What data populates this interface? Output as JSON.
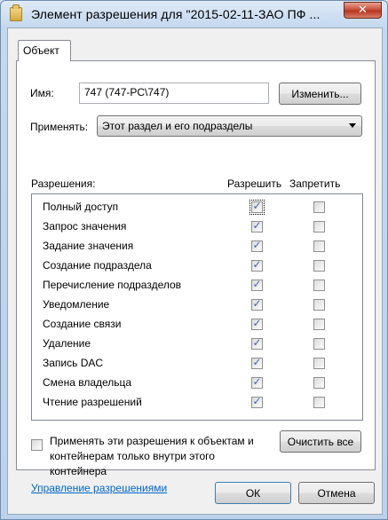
{
  "window": {
    "title": "Элемент разрешения для \"2015-02-11-ЗАО ПФ ...",
    "close_glyph": "✕"
  },
  "tabs": [
    {
      "label": "Объект"
    }
  ],
  "name_field": {
    "label": "Имя:",
    "value": "747 (747-PC\\747)"
  },
  "change_button": {
    "label": "Изменить..."
  },
  "apply_to": {
    "label": "Применять:",
    "value": "Этот раздел и его подразделы"
  },
  "permissions": {
    "header": "Разрешения:",
    "allow_header": "Разрешить",
    "deny_header": "Запретить",
    "rows": [
      {
        "name": "Полный доступ",
        "allow": true,
        "deny": false
      },
      {
        "name": "Запрос значения",
        "allow": true,
        "deny": false
      },
      {
        "name": "Задание значения",
        "allow": true,
        "deny": false
      },
      {
        "name": "Создание подраздела",
        "allow": true,
        "deny": false
      },
      {
        "name": "Перечисление подразделов",
        "allow": true,
        "deny": false
      },
      {
        "name": "Уведомление",
        "allow": true,
        "deny": false
      },
      {
        "name": "Создание связи",
        "allow": true,
        "deny": false
      },
      {
        "name": "Удаление",
        "allow": true,
        "deny": false
      },
      {
        "name": "Запись DAC",
        "allow": true,
        "deny": false
      },
      {
        "name": "Смена владельца",
        "allow": true,
        "deny": false
      },
      {
        "name": "Чтение разрешений",
        "allow": true,
        "deny": false
      }
    ]
  },
  "apply_inside": {
    "label": "Применять эти разрешения к объектам и контейнерам только внутри этого контейнера",
    "checked": false
  },
  "clear_all_button": {
    "label": "Очистить все"
  },
  "manage_link": {
    "label": "Управление разрешениями"
  },
  "ok_button": {
    "label": "ОК"
  },
  "cancel_button": {
    "label": "Отмена"
  },
  "check_glyph": "✓"
}
